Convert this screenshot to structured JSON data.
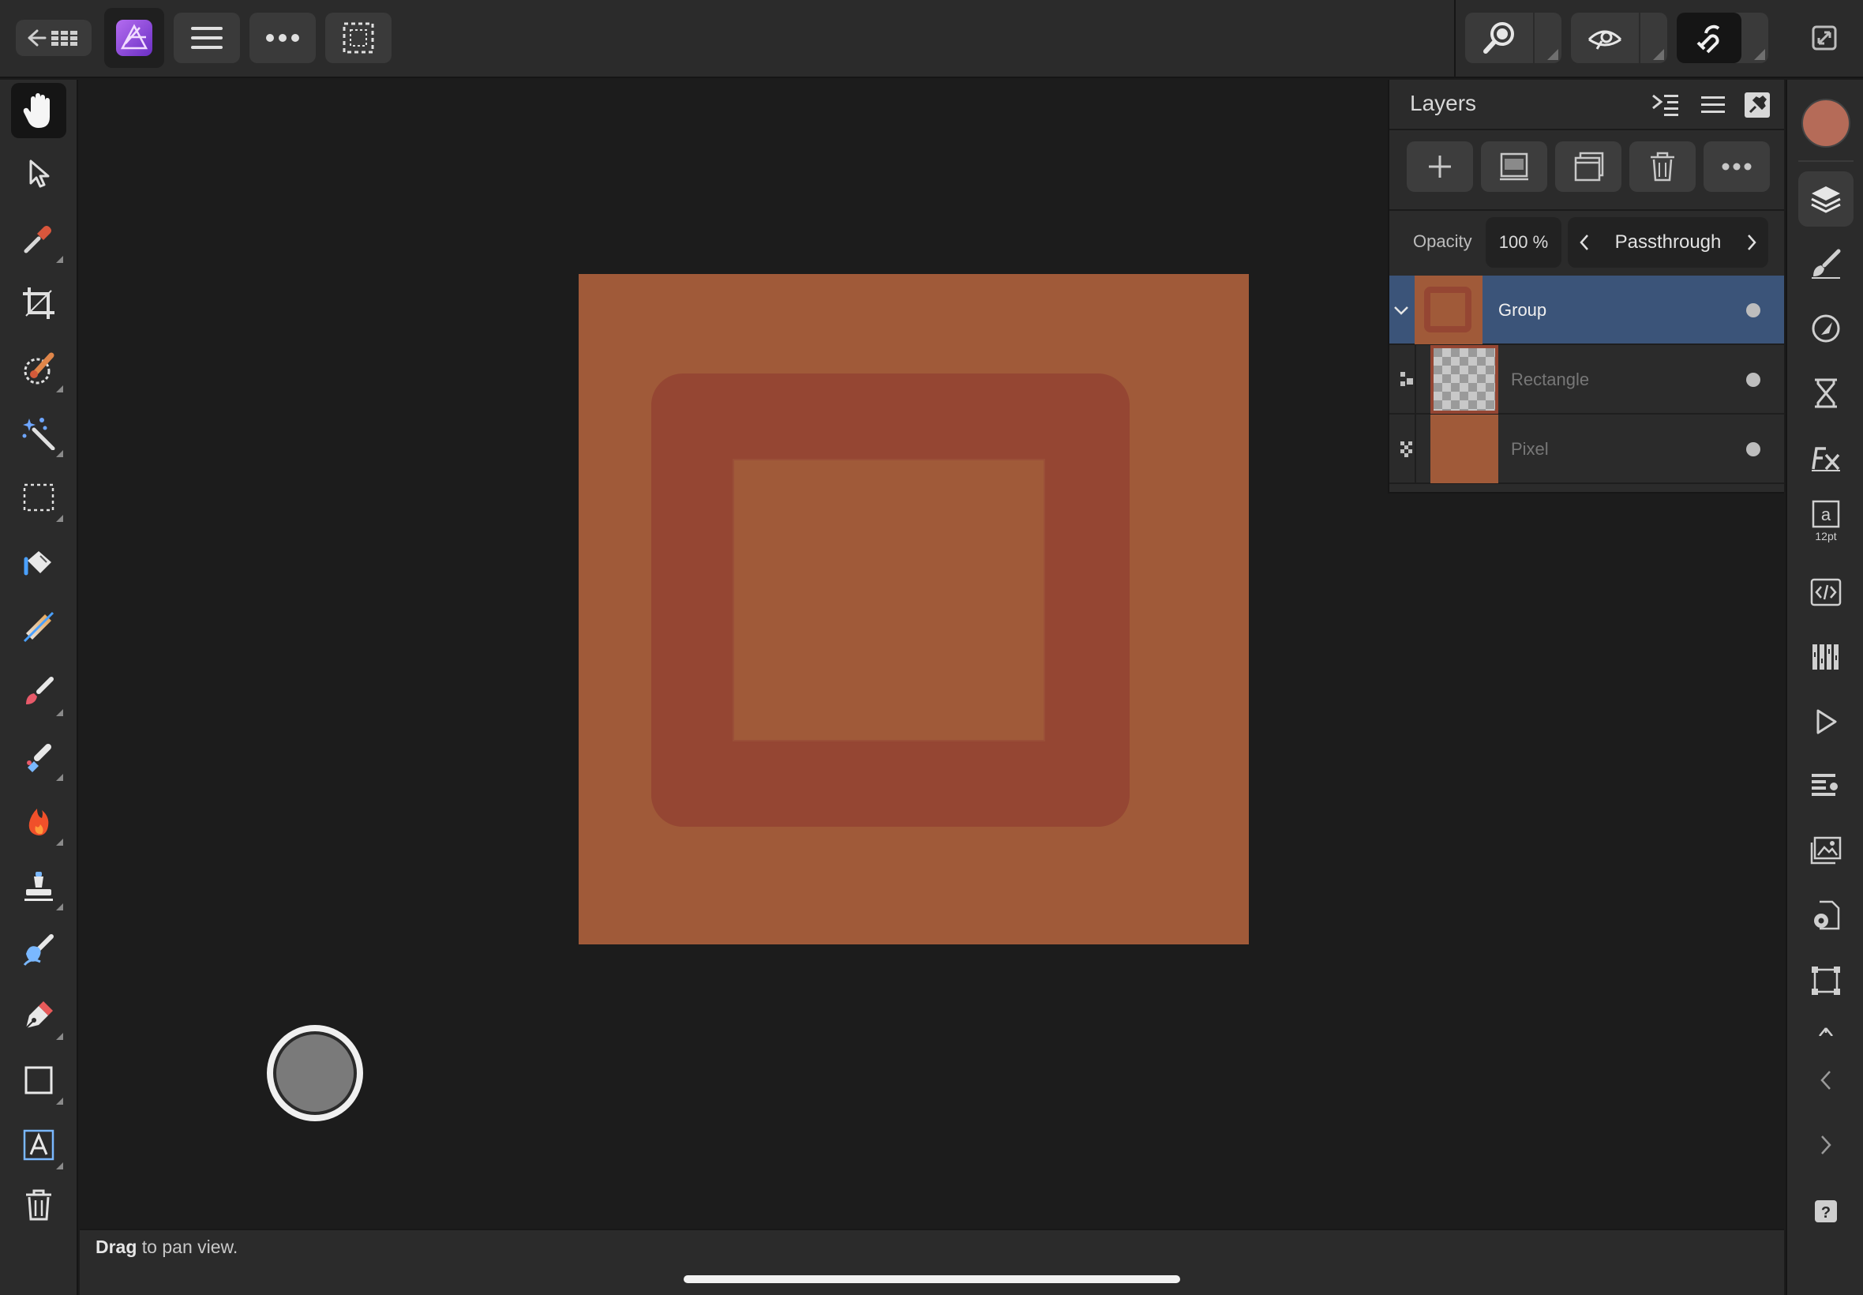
{
  "layers_panel": {
    "title": "Layers",
    "opacity_label": "Opacity",
    "opacity_value": "100 %",
    "blend_mode": "Passthrough",
    "layers": [
      {
        "name": "Group",
        "selected": true,
        "expanded": true
      },
      {
        "name": "Rectangle",
        "selected": false
      },
      {
        "name": "Pixel",
        "selected": false
      }
    ]
  },
  "right_studio": {
    "color_swatch": "#b56b58",
    "text_style_size": "12pt"
  },
  "status": {
    "action": "Drag",
    "rest": " to pan view."
  },
  "colors": {
    "canvas_bg": "#a05a39",
    "rectangle": "#954633",
    "selection": "#3b5479",
    "app_icon": "#8b4fd8"
  }
}
